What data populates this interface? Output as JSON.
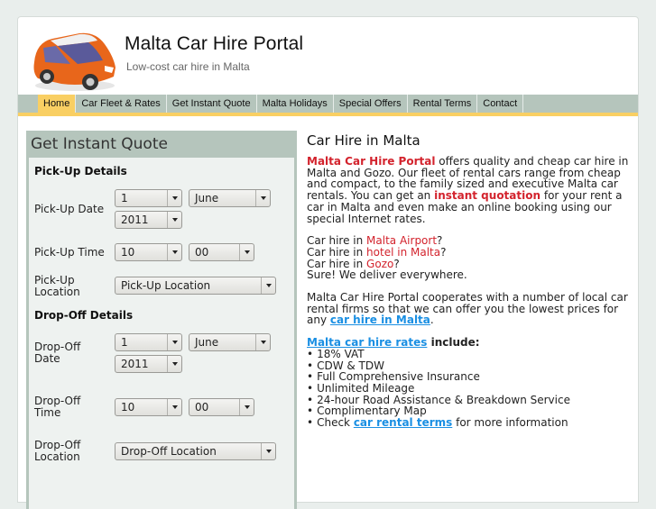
{
  "header": {
    "title": "Malta Car Hire Portal",
    "tagline": "Low-cost car hire in Malta",
    "logo_icon": "orange-car-icon"
  },
  "nav": {
    "items": [
      {
        "label": "Home",
        "active": true
      },
      {
        "label": "Car Fleet & Rates",
        "active": false
      },
      {
        "label": "Get Instant Quote",
        "active": false
      },
      {
        "label": "Malta Holidays",
        "active": false
      },
      {
        "label": "Special Offers",
        "active": false
      },
      {
        "label": "Rental Terms",
        "active": false
      },
      {
        "label": "Contact",
        "active": false
      }
    ]
  },
  "quote": {
    "title": "Get Instant Quote",
    "pickup": {
      "heading": "Pick-Up Details",
      "date_label": "Pick-Up Date",
      "day": "1",
      "month": "June",
      "year": "2011",
      "time_label": "Pick-Up Time",
      "hour": "10",
      "minute": "00",
      "location_label_1": "Pick-Up",
      "location_label_2": "Location",
      "location": "Pick-Up Location"
    },
    "dropoff": {
      "heading": "Drop-Off Details",
      "date_label_1": "Drop-Off",
      "date_label_2": "Date",
      "day": "1",
      "month": "June",
      "year": "2011",
      "time_label_1": "Drop-Off",
      "time_label_2": "Time",
      "hour": "10",
      "minute": "00",
      "location_label_1": "Drop-Off",
      "location_label_2": "Location",
      "location": "Drop-Off Location"
    }
  },
  "content": {
    "heading": "Car Hire in Malta",
    "intro": {
      "brand": "Malta Car Hire Portal",
      "text1": " offers quality and cheap car hire in Malta and Gozo. Our fleet of rental cars range from cheap and compact, to the family sized and executive Malta car rentals. You can get an ",
      "link": "instant quotation",
      "text2": " for your rent a car in Malta and even make an online booking using our special Internet rates."
    },
    "locations": [
      {
        "prefix": "Car hire in ",
        "link": "Malta Airport",
        "suffix": "?"
      },
      {
        "prefix": "Car hire in ",
        "link": "hotel in Malta",
        "suffix": "?"
      },
      {
        "prefix": "Car hire in ",
        "link": "Gozo",
        "suffix": "?"
      }
    ],
    "deliver": "Sure! We deliver everywhere.",
    "cooperate": {
      "text": "Malta Car Hire Portal cooperates with a number of local car rental firms so that we can offer you the lowest prices for any ",
      "link": "car hire in Malta",
      "suffix": "."
    },
    "rates": {
      "link": "Malta car hire rates",
      "suffix": " include:",
      "items": [
        "18% VAT",
        "CDW & TDW",
        "Full Comprehensive Insurance",
        "Unlimited Mileage",
        "24-hour Road Assistance & Breakdown Service",
        "Complimentary Map"
      ],
      "last": {
        "prefix": "Check ",
        "link": "car rental terms",
        "suffix": " for more information"
      }
    }
  }
}
